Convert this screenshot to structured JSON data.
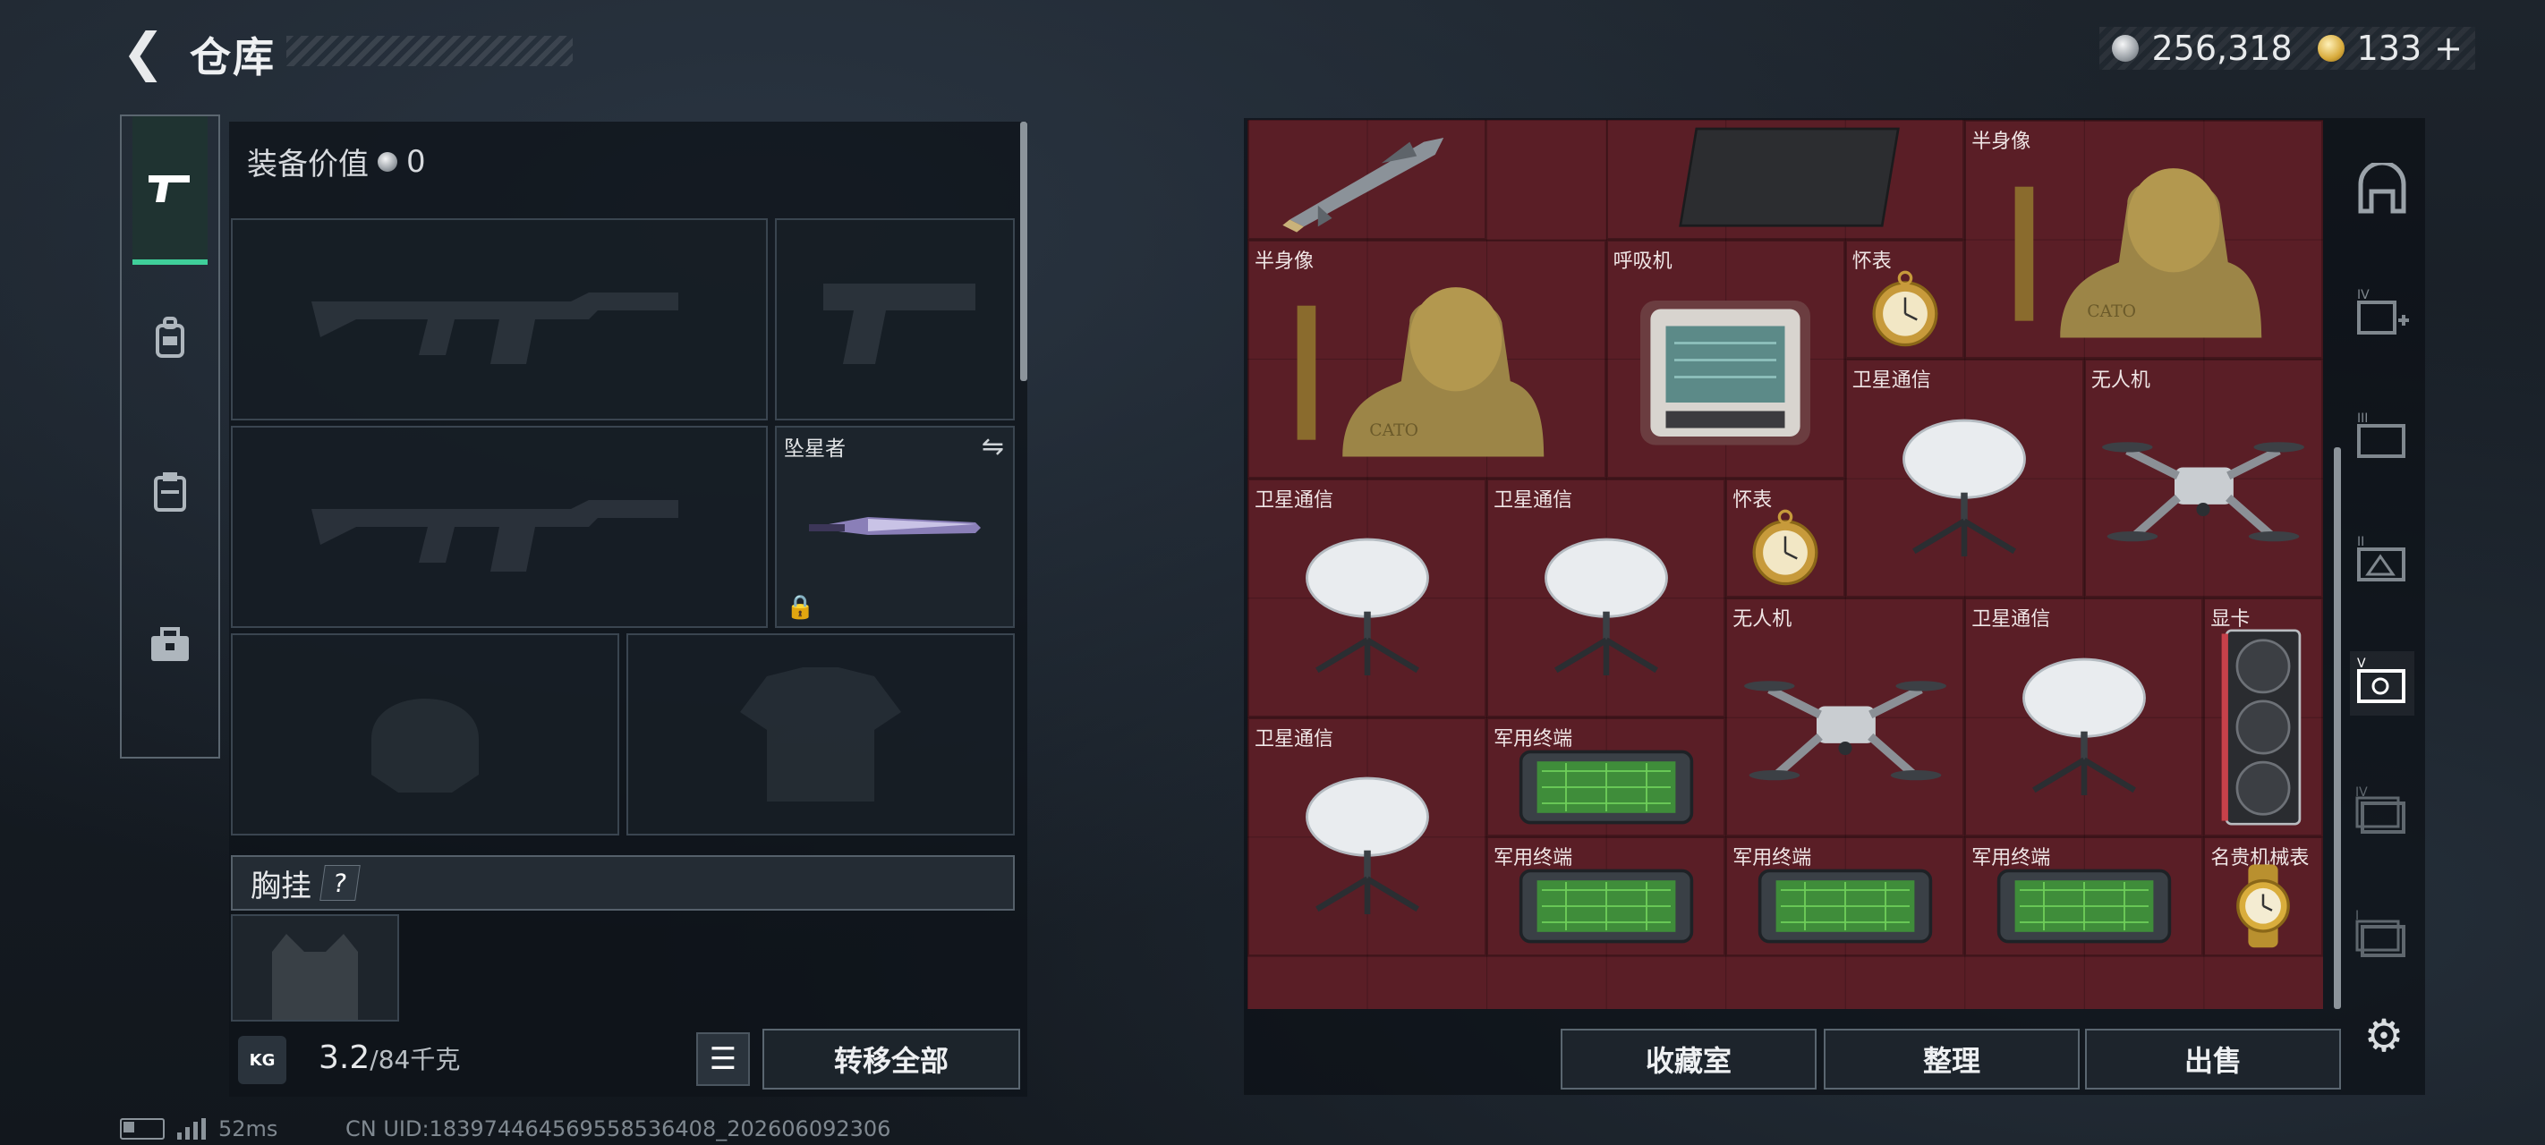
{
  "header": {
    "back_glyph": "❮",
    "title": "仓库",
    "silver_amount": "256,318",
    "gold_amount": "133",
    "gold_plus": "+"
  },
  "left_tabs": [
    {
      "icon": "pistol-icon",
      "active": true
    },
    {
      "icon": "backpack-icon",
      "active": false
    },
    {
      "icon": "clipboard-icon",
      "active": false
    },
    {
      "icon": "toolbox-icon",
      "active": false
    }
  ],
  "equipment": {
    "value_label": "装备价值",
    "value": "0",
    "melee_label": "坠星者",
    "chest_rig_label": "胸挂",
    "chest_rig_help": "?"
  },
  "bottom_left": {
    "kg_badge": "KG",
    "weight_current": "3.2",
    "weight_max": "/84千克",
    "transfer_all": "转移全部"
  },
  "stash_items": [
    {
      "id": "missile",
      "name": "",
      "type": "missile"
    },
    {
      "id": "cloth",
      "name": "",
      "type": "cloth"
    },
    {
      "id": "bust1",
      "name": "半身像",
      "type": "bust"
    },
    {
      "id": "bust2",
      "name": "半身像",
      "type": "bust"
    },
    {
      "id": "ventilator",
      "name": "呼吸机",
      "type": "ventilator"
    },
    {
      "id": "watch1",
      "name": "怀表",
      "type": "pocketwatch"
    },
    {
      "id": "sat1",
      "name": "卫星通信",
      "type": "satellite"
    },
    {
      "id": "drone1",
      "name": "无人机",
      "type": "drone"
    },
    {
      "id": "sat2",
      "name": "卫星通信",
      "type": "satellite"
    },
    {
      "id": "sat3",
      "name": "卫星通信",
      "type": "satellite"
    },
    {
      "id": "watch2",
      "name": "怀表",
      "type": "pocketwatch"
    },
    {
      "id": "drone2",
      "name": "无人机",
      "type": "drone"
    },
    {
      "id": "sat4",
      "name": "卫星通信",
      "type": "satellite"
    },
    {
      "id": "gpu",
      "name": "显卡",
      "type": "gpu"
    },
    {
      "id": "sat5",
      "name": "卫星通信",
      "type": "satellite"
    },
    {
      "id": "term1",
      "name": "军用终端",
      "type": "terminal"
    },
    {
      "id": "term2",
      "name": "军用终端",
      "type": "terminal"
    },
    {
      "id": "term3",
      "name": "军用终端",
      "type": "terminal"
    },
    {
      "id": "term4",
      "name": "军用终端",
      "type": "terminal"
    },
    {
      "id": "luxwatch",
      "name": "名贵机械表",
      "type": "wristwatch"
    }
  ],
  "right_sidebar": [
    {
      "icon": "vault-icon",
      "tier": ""
    },
    {
      "icon": "stash-add-icon",
      "tier": "IV"
    },
    {
      "icon": "stash-tier3-icon",
      "tier": "III"
    },
    {
      "icon": "stash-tier2-icon",
      "tier": "II"
    },
    {
      "icon": "stash-current-icon",
      "tier": "V",
      "active": true
    },
    {
      "icon": "stash-tier4-icon",
      "tier": "IV"
    },
    {
      "icon": "stash-tier1-icon",
      "tier": "I"
    }
  ],
  "actions": {
    "collection": "收藏室",
    "organize": "整理",
    "sell": "出售"
  },
  "status_bar": {
    "latency": "52ms",
    "uid": "CN UID:18397446456955853​6408_202606092306"
  },
  "colors": {
    "accent_green": "#3fcf9a",
    "grid_red": "#5a1e26",
    "panel_dark": "#0e1319"
  }
}
